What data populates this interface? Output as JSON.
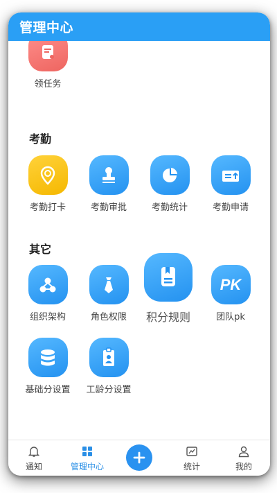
{
  "header": {
    "title": "管理中心"
  },
  "tasks": {
    "claim_task_label": "领任务"
  },
  "attendance": {
    "section_title": "考勤",
    "items": [
      {
        "label": "考勤打卡",
        "icon": "location-pin-icon"
      },
      {
        "label": "考勤审批",
        "icon": "stamp-icon"
      },
      {
        "label": "考勤统计",
        "icon": "pie-chart-icon"
      },
      {
        "label": "考勤申请",
        "icon": "apply-upload-icon"
      }
    ]
  },
  "other": {
    "section_title": "其它",
    "items": [
      {
        "label": "组织架构",
        "icon": "org-structure-icon"
      },
      {
        "label": "角色权限",
        "icon": "tie-icon"
      },
      {
        "label": "积分规则",
        "icon": "rules-document-icon"
      },
      {
        "label": "团队pk",
        "icon": "pk-icon",
        "icon_text": "PK"
      },
      {
        "label": "基础分设置",
        "icon": "database-icon"
      },
      {
        "label": "工龄分设置",
        "icon": "badge-icon"
      }
    ]
  },
  "tabbar": {
    "items": [
      {
        "label": "通知",
        "icon": "bell-icon"
      },
      {
        "label": "管理中心",
        "icon": "grid-icon",
        "active": true
      },
      {
        "label": "",
        "icon": "plus-icon"
      },
      {
        "label": "统计",
        "icon": "chart-icon"
      },
      {
        "label": "我的",
        "icon": "user-icon"
      }
    ]
  },
  "colors": {
    "primary": "#2a9ff5",
    "icon_blue": "#2492f0",
    "icon_yellow": "#f5b800",
    "icon_red": "#ee6560",
    "active_tab": "#2a8fe6"
  }
}
